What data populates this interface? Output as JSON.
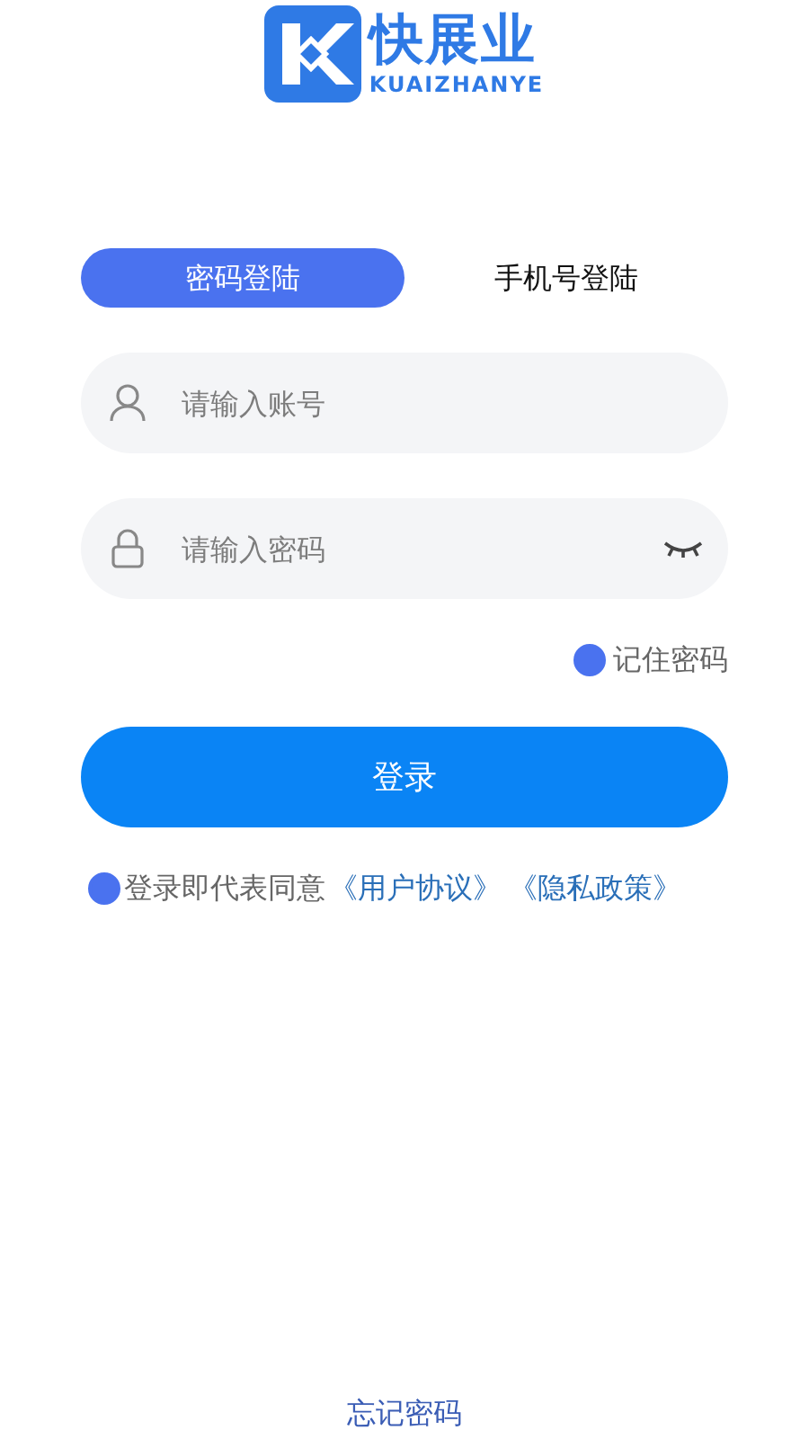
{
  "logo": {
    "title": "快展业",
    "subtitle": "KUAIZHANYE"
  },
  "tabs": [
    {
      "label": "密码登陆",
      "selected": true
    },
    {
      "label": "手机号登陆",
      "selected": false
    }
  ],
  "fields": [
    {
      "kind": "account",
      "placeholder": "请输入账号"
    },
    {
      "kind": "password",
      "placeholder": "请输入密码"
    }
  ],
  "remember": {
    "label": "记住密码",
    "checked": true
  },
  "login_button": "登录",
  "agreement": {
    "checked": true,
    "text": "登录即代表同意",
    "links": [
      "《用户协议》",
      "《隐私政策》"
    ]
  },
  "forgot": "忘记密码"
}
